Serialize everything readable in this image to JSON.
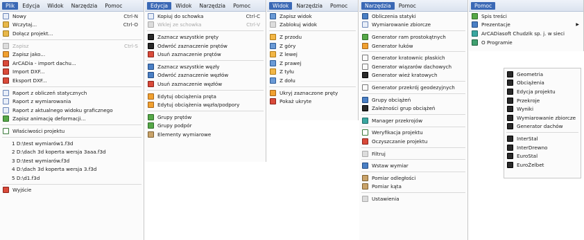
{
  "panels": [
    {
      "id": "plik",
      "menubar": [
        "Plik",
        "Edycja",
        "Widok",
        "Narzędzia",
        "Pomoc"
      ],
      "active": 0,
      "items": [
        {
          "label": "Nowy",
          "shortcut": "Ctrl-N",
          "icon": "doc"
        },
        {
          "label": "Wczytaj...",
          "shortcut": "Ctrl-O",
          "icon": "folder"
        },
        {
          "label": "Dołącz projekt...",
          "icon": "folder"
        },
        {
          "sep": true
        },
        {
          "label": "Zapisz",
          "shortcut": "Ctrl-S",
          "icon": "grey",
          "disabled": true
        },
        {
          "label": "Zapisz jako...",
          "icon": "orange"
        },
        {
          "label": "ArCADia - import dachu...",
          "icon": "red"
        },
        {
          "label": "Import DXF...",
          "icon": "red"
        },
        {
          "label": "Eksport DXF...",
          "icon": "red"
        },
        {
          "sep": true
        },
        {
          "label": "Raport z obliczeń statycznych",
          "icon": "doc"
        },
        {
          "label": "Raport z wymiarowania",
          "icon": "doc"
        },
        {
          "label": "Raport z aktualnego widoku graficznego",
          "icon": "doc"
        },
        {
          "label": "Zapisz animację deformacji...",
          "icon": "green"
        },
        {
          "sep": true
        },
        {
          "label": "Właściwości projektu",
          "icon": "checks"
        },
        {
          "sep": true
        },
        {
          "label": "1 D:\\test wymiarów1.f3d",
          "plain": true
        },
        {
          "label": "2 D:\\dach 3d koperta wersja 3aaa.f3d",
          "plain": true
        },
        {
          "label": "3 D:\\test wymiarów.f3d",
          "plain": true
        },
        {
          "label": "4 D:\\dach 3d koperta wersja 3.f3d",
          "plain": true
        },
        {
          "label": "5 D:\\d1.f3d",
          "plain": true
        },
        {
          "sep": true
        },
        {
          "label": "Wyjście",
          "icon": "red"
        }
      ]
    },
    {
      "id": "edycja",
      "menubar": [
        "Edycja",
        "Widok",
        "Narzędzia",
        "Pomoc"
      ],
      "active": 0,
      "items": [
        {
          "label": "Kopiuj do schowka",
          "shortcut": "Ctrl-C",
          "icon": "doc"
        },
        {
          "label": "Wklej ze schowka",
          "shortcut": "Ctrl-V",
          "icon": "grey",
          "disabled": true
        },
        {
          "sep": true
        },
        {
          "label": "Zaznacz wszystkie pręty",
          "icon": "dark"
        },
        {
          "label": "Odwróć zaznaczenie prętów",
          "icon": "dark"
        },
        {
          "label": "Usuń zaznaczenie prętów",
          "icon": "red"
        },
        {
          "sep": true
        },
        {
          "label": "Zaznacz wszystkie węzły",
          "icon": "blue"
        },
        {
          "label": "Odwróć zaznaczenie węzłów",
          "icon": "blue"
        },
        {
          "label": "Usuń zaznaczenie węzłów",
          "icon": "red"
        },
        {
          "sep": true
        },
        {
          "label": "Edytuj obciążenia pręta",
          "icon": "orange"
        },
        {
          "label": "Edytuj obciążenia węzła/podpory",
          "icon": "orange"
        },
        {
          "sep": true
        },
        {
          "label": "Grupy prętów",
          "icon": "green"
        },
        {
          "label": "Grupy podpór",
          "icon": "green"
        },
        {
          "label": "Elementy wymiarowe",
          "icon": "ruler"
        }
      ]
    },
    {
      "id": "widok",
      "menubar": [
        "Widok",
        "Narzędzia",
        "Pomoc"
      ],
      "active": 0,
      "items": [
        {
          "label": "Zapisz widok",
          "icon": "cube"
        },
        {
          "label": "Zablokuj widok",
          "icon": "grey"
        },
        {
          "sep": true
        },
        {
          "label": "Z przodu",
          "icon": "cube-o"
        },
        {
          "label": "Z góry",
          "icon": "cube"
        },
        {
          "label": "Z lewej",
          "icon": "cube-o"
        },
        {
          "label": "Z prawej",
          "icon": "cube"
        },
        {
          "label": "Z tyłu",
          "icon": "cube-o"
        },
        {
          "label": "Z dołu",
          "icon": "cube"
        },
        {
          "sep": true
        },
        {
          "label": "Ukryj zaznaczone pręty",
          "icon": "orange"
        },
        {
          "label": "Pokaż ukryte",
          "icon": "red"
        }
      ]
    },
    {
      "id": "narzedzia",
      "menubar": [
        "Narzędzia",
        "Pomoc"
      ],
      "active": 0,
      "items": [
        {
          "label": "Obliczenia statyki",
          "icon": "blue"
        },
        {
          "label": "Wymiarowanie zbiorcze",
          "icon": "doc"
        },
        {
          "sep": true
        },
        {
          "label": "Generator ram prostokątnych",
          "icon": "green"
        },
        {
          "label": "Generator łuków",
          "icon": "orange"
        },
        {
          "sep": true
        },
        {
          "label": "Generator kratownic płaskich",
          "icon": "line"
        },
        {
          "label": "Generator wiązarów dachowych",
          "icon": "line"
        },
        {
          "label": "Generator wież kratowych",
          "icon": "dark"
        },
        {
          "sep": true
        },
        {
          "label": "Generator przekrój geodezyjnych",
          "icon": "line"
        },
        {
          "sep": true
        },
        {
          "label": "Grupy obciążeń",
          "icon": "blue"
        },
        {
          "label": "Zależności grup obciążeń",
          "icon": "dark"
        },
        {
          "sep": true
        },
        {
          "label": "Manager przekrojów",
          "icon": "teal"
        },
        {
          "sep": true
        },
        {
          "label": "Weryfikacja projektu",
          "icon": "checks"
        },
        {
          "label": "Oczyszczanie projektu",
          "icon": "red"
        },
        {
          "sep": true
        },
        {
          "label": "Filtruj",
          "icon": "grey"
        },
        {
          "sep": true
        },
        {
          "label": "Wstaw wymiar",
          "icon": "blue"
        },
        {
          "sep": true
        },
        {
          "label": "Pomiar odległości",
          "icon": "ruler"
        },
        {
          "label": "Pomiar kąta",
          "icon": "ruler"
        },
        {
          "sep": true
        },
        {
          "label": "Ustawienia",
          "icon": "grey"
        }
      ]
    },
    {
      "id": "pomoc",
      "menubar": [
        "Pomoc"
      ],
      "active": 0,
      "items": [
        {
          "label": "Spis treści",
          "icon": "green"
        },
        {
          "label": "Prezentacje",
          "icon": "blue",
          "submenu": true
        },
        {
          "label": "ArCADiasoft Chudzik sp. j. w sieci",
          "icon": "teal"
        },
        {
          "label": "O Programie",
          "icon": "globe"
        }
      ]
    },
    {
      "id": "prezentacje",
      "items": [
        {
          "label": "Geometria",
          "icon": "dark"
        },
        {
          "label": "Obciążenia",
          "icon": "dark"
        },
        {
          "label": "Edycja projektu",
          "icon": "dark"
        },
        {
          "label": "Przekroje",
          "icon": "dark"
        },
        {
          "label": "Wyniki",
          "icon": "dark"
        },
        {
          "label": "Wymiarowanie zbiorcze",
          "icon": "dark"
        },
        {
          "label": "Generator dachów",
          "icon": "dark"
        },
        {
          "sep": true
        },
        {
          "label": "InterStal",
          "icon": "dark"
        },
        {
          "label": "InterDrewno",
          "icon": "dark"
        },
        {
          "label": "EuroStal",
          "icon": "dark"
        },
        {
          "label": "EuroŻelbet",
          "icon": "dark"
        }
      ]
    }
  ]
}
